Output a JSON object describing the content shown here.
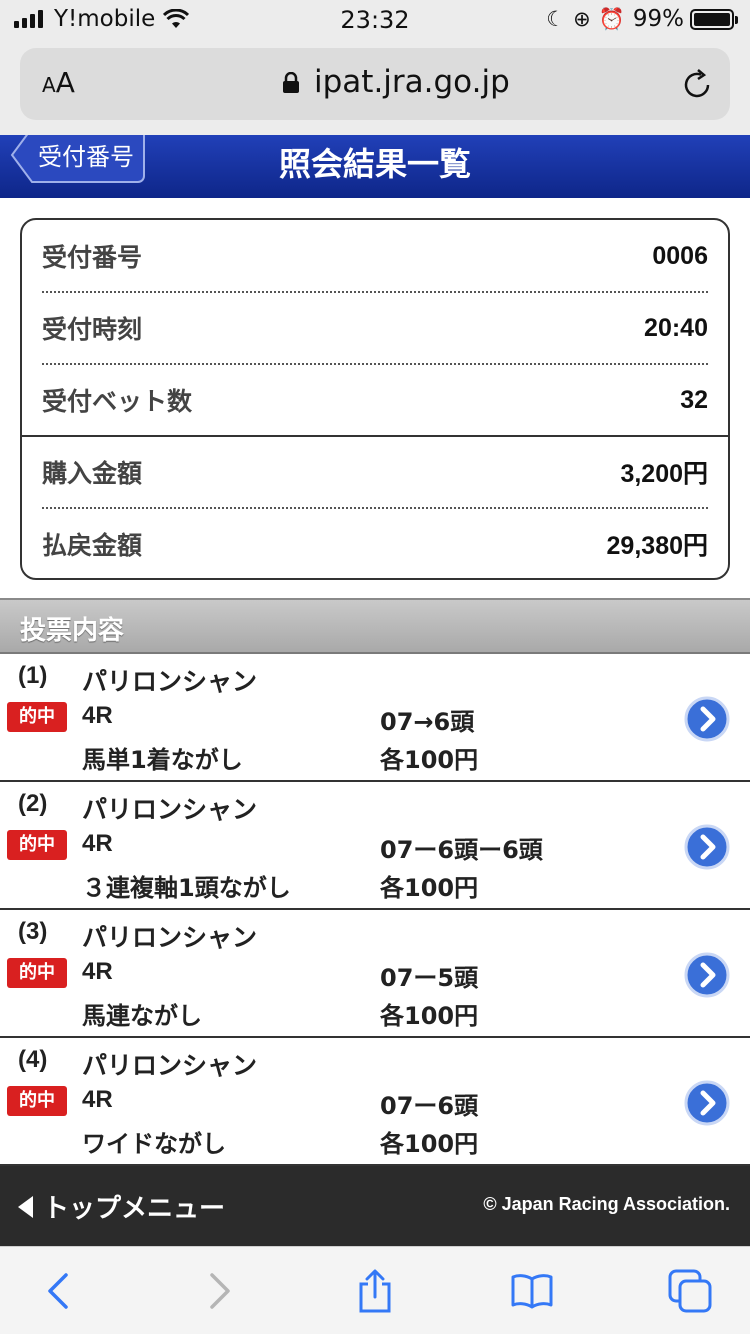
{
  "status_bar": {
    "carrier": "Y!mobile",
    "time": "23:32",
    "battery_percent": "99%",
    "battery_level": 0.99
  },
  "browser": {
    "aa_label": "AA",
    "url": "ipat.jra.go.jp"
  },
  "header": {
    "back_label": "受付番号",
    "title": "照会結果一覧"
  },
  "summary": [
    {
      "label": "受付番号",
      "value": "0006"
    },
    {
      "label": "受付時刻",
      "value": "20:40"
    },
    {
      "label": "受付ベット数",
      "value": "32"
    },
    {
      "label": "購入金額",
      "value": "3,200円"
    },
    {
      "label": "払戻金額",
      "value": "29,380円"
    }
  ],
  "section_title": "投票内容",
  "bets": [
    {
      "index": "(1)",
      "horse": "パリロンシャン",
      "hit": "的中",
      "race": "4R",
      "kind": "馬単1着ながし",
      "combo": "07→6頭",
      "amount": "各100円"
    },
    {
      "index": "(2)",
      "horse": "パリロンシャン",
      "hit": "的中",
      "race": "4R",
      "kind": "３連複軸1頭ながし",
      "combo": "07ー6頭ー6頭",
      "amount": "各100円"
    },
    {
      "index": "(3)",
      "horse": "パリロンシャン",
      "hit": "的中",
      "race": "4R",
      "kind": "馬連ながし",
      "combo": "07ー5頭",
      "amount": "各100円"
    },
    {
      "index": "(4)",
      "horse": "パリロンシャン",
      "hit": "的中",
      "race": "4R",
      "kind": "ワイドながし",
      "combo": "07ー6頭",
      "amount": "各100円"
    }
  ],
  "footer": {
    "top_menu": "トップメニュー",
    "copyright": "© Japan Racing Association."
  },
  "colors": {
    "header_blue": "#1530a0",
    "hit_red": "#d92020",
    "ios_blue": "#3478f6"
  },
  "toolbar_icons": [
    "back-icon",
    "forward-icon",
    "share-icon",
    "bookmarks-icon",
    "tabs-icon"
  ]
}
